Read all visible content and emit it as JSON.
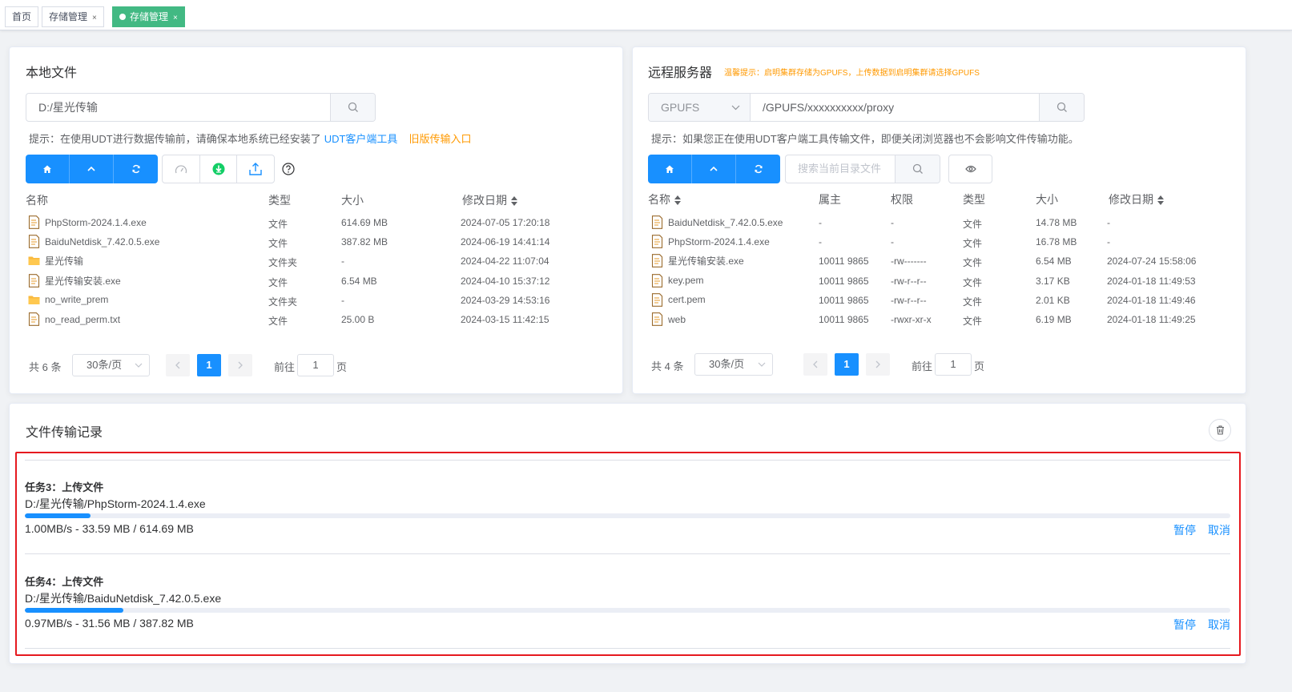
{
  "tabs": [
    {
      "label": "首页",
      "closable": false,
      "active": false
    },
    {
      "label": "存储管理",
      "closable": true,
      "active": false
    },
    {
      "label": "存储管理",
      "closable": true,
      "active": true
    }
  ],
  "tab_close": "×",
  "local": {
    "title": "本地文件",
    "path": "D:/星光传输",
    "hint_text": "提示：在使用UDT进行数据传输前，请确保本地系统已经安装了",
    "hint_link": "UDT客户端工具",
    "hint_link2": "旧版传输入口",
    "columns": {
      "name": "名称",
      "type": "类型",
      "size": "大小",
      "modified": "修改日期"
    },
    "rows": [
      {
        "icon": "file",
        "name": "PhpStorm-2024.1.4.exe",
        "type": "文件",
        "size": "614.69 MB",
        "modified": "2024-07-05 17:20:18"
      },
      {
        "icon": "file",
        "name": "BaiduNetdisk_7.42.0.5.exe",
        "type": "文件",
        "size": "387.82 MB",
        "modified": "2024-06-19 14:41:14"
      },
      {
        "icon": "folder",
        "name": "星光传输",
        "type": "文件夹",
        "size": "-",
        "modified": "2024-04-22 11:07:04"
      },
      {
        "icon": "file",
        "name": "星光传输安装.exe",
        "type": "文件",
        "size": "6.54 MB",
        "modified": "2024-04-10 15:37:12"
      },
      {
        "icon": "folder",
        "name": "no_write_prem",
        "type": "文件夹",
        "size": "-",
        "modified": "2024-03-29 14:53:16"
      },
      {
        "icon": "file",
        "name": "no_read_perm.txt",
        "type": "文件",
        "size": "25.00 B",
        "modified": "2024-03-15 11:42:15"
      }
    ],
    "pagination": {
      "total": "共 6 条",
      "page_size": "30条/页",
      "current": "1",
      "goto_prefix": "前往",
      "goto_value": "1",
      "goto_suffix": "页"
    }
  },
  "remote": {
    "title": "远程服务器",
    "warning": "温馨提示：启明集群存储为GPUFS，上传数据到启明集群请选择GPUFS",
    "storage_select": "GPUFS",
    "path": "/GPUFS/xxxxxxxxxx/proxy",
    "hint_text": "提示：如果您正在使用UDT客户端工具传输文件，即便关闭浏览器也不会影响文件传输功能。",
    "search_placeholder": "搜索当前目录文件",
    "columns": {
      "name": "名称",
      "owner": "属主",
      "perm": "权限",
      "type": "类型",
      "size": "大小",
      "modified": "修改日期"
    },
    "rows": [
      {
        "name": "BaiduNetdisk_7.42.0.5.exe",
        "owner": "-",
        "perm": "-",
        "type": "文件",
        "size": "14.78 MB",
        "modified": "-"
      },
      {
        "name": "PhpStorm-2024.1.4.exe",
        "owner": "-",
        "perm": "-",
        "type": "文件",
        "size": "16.78 MB",
        "modified": "-"
      },
      {
        "name": "星光传输安装.exe",
        "owner": "10011 9865",
        "perm": "-rw-------",
        "type": "文件",
        "size": "6.54 MB",
        "modified": "2024-07-24 15:58:06"
      },
      {
        "name": "key.pem",
        "owner": "10011 9865",
        "perm": "-rw-r--r--",
        "type": "文件",
        "size": "3.17 KB",
        "modified": "2024-01-18 11:49:53"
      },
      {
        "name": "cert.pem",
        "owner": "10011 9865",
        "perm": "-rw-r--r--",
        "type": "文件",
        "size": "2.01 KB",
        "modified": "2024-01-18 11:49:46"
      },
      {
        "name": "web",
        "owner": "10011 9865",
        "perm": "-rwxr-xr-x",
        "type": "文件",
        "size": "6.19 MB",
        "modified": "2024-01-18 11:49:25"
      }
    ],
    "pagination": {
      "total": "共 4 条",
      "page_size": "30条/页",
      "current": "1",
      "goto_prefix": "前往",
      "goto_value": "1",
      "goto_suffix": "页"
    }
  },
  "transfers": {
    "title": "文件传输记录",
    "tasks": [
      {
        "title": "任务3：上传文件",
        "path": "D:/星光传输/PhpStorm-2024.1.4.exe",
        "speed": "1.00MB/s - 33.59 MB / 614.69 MB",
        "progress": 0.0546,
        "pause": "暂停",
        "cancel": "取消"
      },
      {
        "title": "任务4：上传文件",
        "path": "D:/星光传输/BaiduNetdisk_7.42.0.5.exe",
        "speed": "0.97MB/s - 31.56 MB / 387.82 MB",
        "progress": 0.0814,
        "pause": "暂停",
        "cancel": "取消"
      }
    ]
  },
  "colors": {
    "primary": "#1890ff",
    "success_tab": "#42b983",
    "warning": "#ff9900",
    "highlight_border": "#e6191f"
  }
}
